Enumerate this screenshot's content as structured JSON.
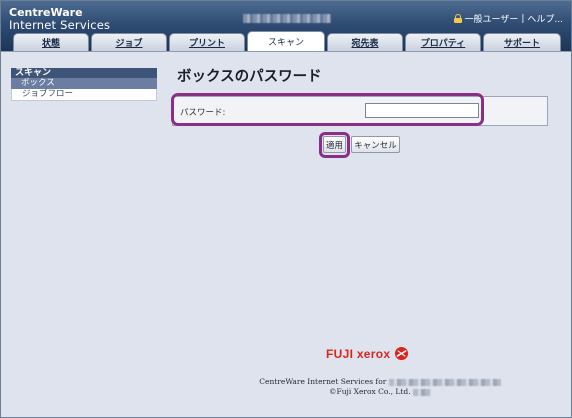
{
  "header": {
    "brand_line1": "CentreWare",
    "brand_line2": "Internet Services",
    "user_label": "一般ユーザー",
    "separator": "|",
    "help_label": "ヘルプ..."
  },
  "tabs": [
    {
      "label": "状態"
    },
    {
      "label": "ジョブ"
    },
    {
      "label": "プリント"
    },
    {
      "label": "スキャン",
      "active": true
    },
    {
      "label": "宛先表"
    },
    {
      "label": "プロパティ"
    },
    {
      "label": "サポート"
    }
  ],
  "sidebar": {
    "heading": "スキャン",
    "items": [
      {
        "label": "ボックス",
        "selected": true
      },
      {
        "label": "ジョブフロー",
        "selected": false
      }
    ]
  },
  "main": {
    "title": "ボックスのパスワード",
    "password_label": "パスワード:",
    "password_value": "",
    "apply_label": "適用",
    "cancel_label": "キャンセル"
  },
  "footer": {
    "logo_text": "FUJI xerox",
    "line1_prefix": "CentreWare Internet Services for",
    "line2": "©Fuji Xerox Co., Ltd."
  },
  "colors": {
    "header_bg": "#2f4c73",
    "highlight": "#8a2f86",
    "brand_red": "#d9251c",
    "page_bg": "#dfe3ee"
  }
}
